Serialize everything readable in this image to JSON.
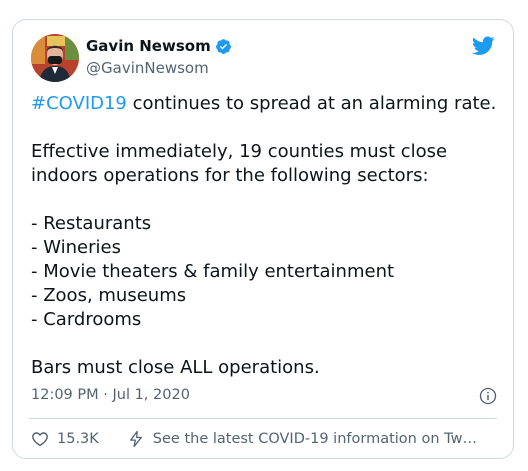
{
  "author": {
    "display_name": "Gavin Newsom",
    "handle": "@GavinNewsom",
    "verified": true,
    "avatar_icon": "user-avatar"
  },
  "tweet": {
    "hashtag": "#COVID19",
    "line1_rest": " continues to spread at an alarming rate.",
    "line2": "Effective immediately, 19 counties must close",
    "line3": "indoors operations for the following sectors:",
    "sectors": [
      "- Restaurants",
      "- Wineries",
      "- Movie theaters & family entertainment",
      "- Zoos, museums",
      "- Cardrooms"
    ],
    "closing": "Bars must close ALL operations."
  },
  "meta": {
    "timestamp": "12:09 PM · Jul 1, 2020",
    "info_icon": "info-icon"
  },
  "actions": {
    "like_count": "15.3K",
    "covid_link": "See the latest COVID-19 information on Tw…"
  },
  "colors": {
    "brand_blue": "#1d9bf0",
    "text_primary": "#0f1419",
    "text_secondary": "#536471",
    "border": "#cfd9de"
  }
}
